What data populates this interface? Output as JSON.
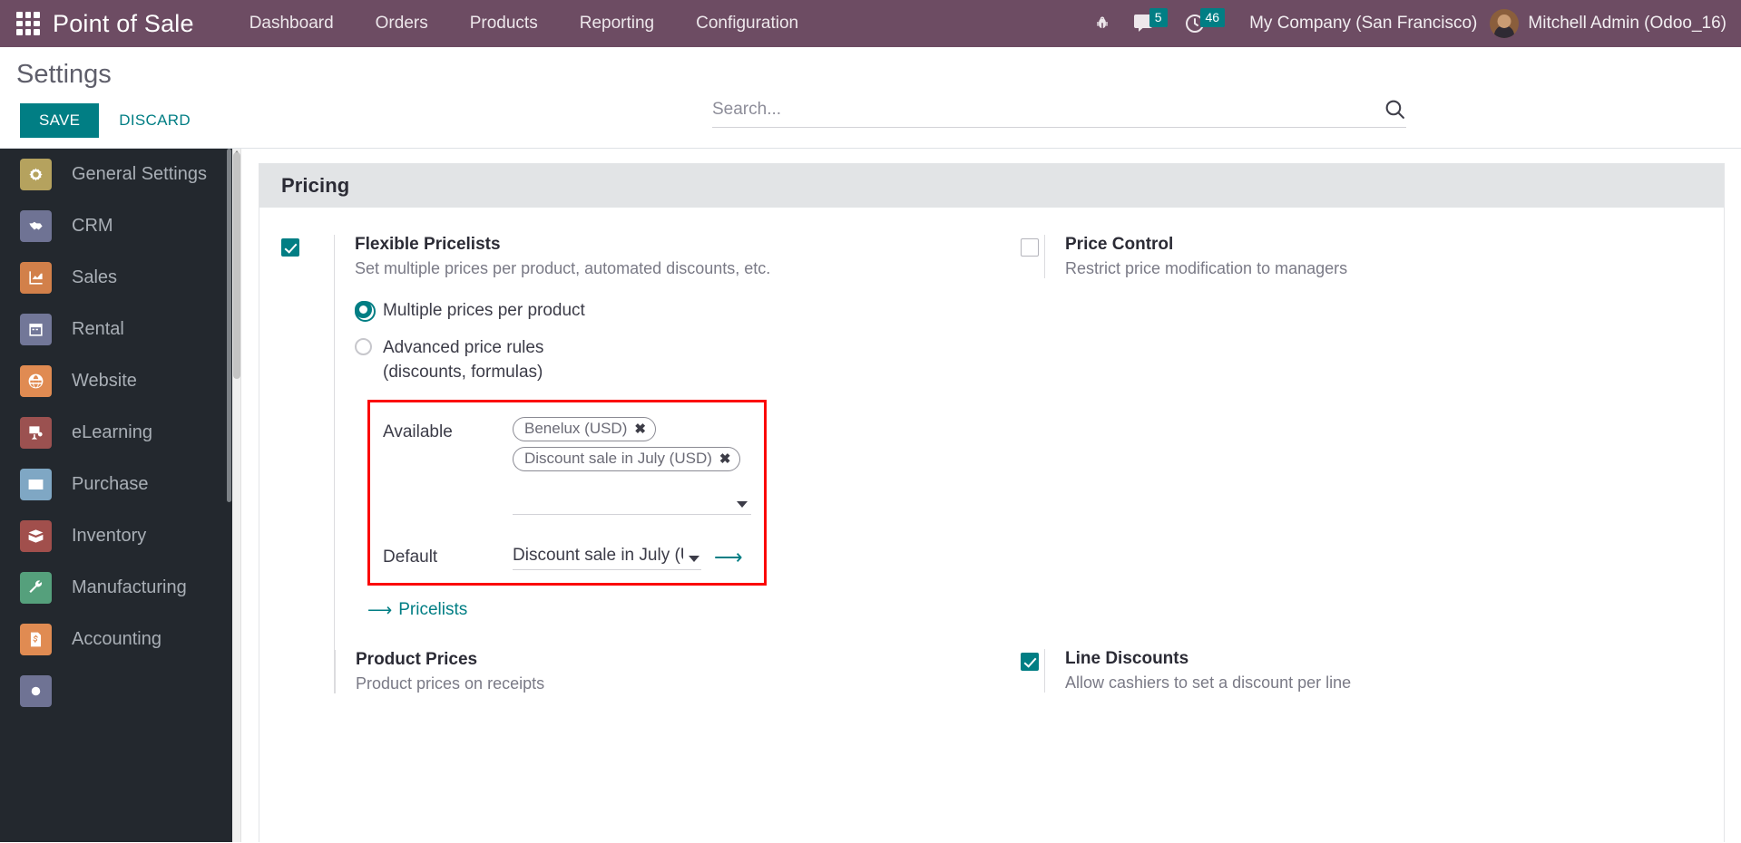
{
  "topbar": {
    "apps_icon": "apps-grid-icon",
    "brand": "Point of Sale",
    "menu": [
      {
        "label": "Dashboard"
      },
      {
        "label": "Orders"
      },
      {
        "label": "Products"
      },
      {
        "label": "Reporting"
      },
      {
        "label": "Configuration"
      }
    ],
    "bug_icon": "bug-icon",
    "messages": {
      "icon": "chat-bubble-icon",
      "count": "5"
    },
    "activities": {
      "icon": "clock-icon",
      "count": "46"
    },
    "company": "My Company (San Francisco)",
    "user": "Mitchell Admin (Odoo_16)",
    "avatar": "user-avatar",
    "accent": "#6d4c63"
  },
  "control_panel": {
    "title": "Settings",
    "save_label": "SAVE",
    "discard_label": "DISCARD",
    "save_color": "#017e84",
    "search": {
      "placeholder": "Search...",
      "value": "",
      "icon": "search-icon"
    }
  },
  "sidebar": {
    "items": [
      {
        "label": "General Settings",
        "icon": "gear-icon",
        "color": "#b5a25e"
      },
      {
        "label": "CRM",
        "icon": "handshake-icon",
        "color": "#6f7394"
      },
      {
        "label": "Sales",
        "icon": "chart-line-icon",
        "color": "#d2804a"
      },
      {
        "label": "Rental",
        "icon": "calendar-icon",
        "color": "#727798"
      },
      {
        "label": "Website",
        "icon": "globe-icon",
        "color": "#e08b52"
      },
      {
        "label": "eLearning",
        "icon": "presentation-icon",
        "color": "#9b5150"
      },
      {
        "label": "Purchase",
        "icon": "credit-card-icon",
        "color": "#7fa7c4"
      },
      {
        "label": "Inventory",
        "icon": "box-icon",
        "color": "#a14f4c"
      },
      {
        "label": "Manufacturing",
        "icon": "wrench-icon",
        "color": "#55a07c"
      },
      {
        "label": "Accounting",
        "icon": "invoice-dollar-icon",
        "color": "#e08b52"
      },
      {
        "label": "",
        "icon": "app-icon",
        "color": "#6f7394"
      }
    ]
  },
  "pricing": {
    "header": "Pricing",
    "flexible_pricelists": {
      "checked": true,
      "title": "Flexible Pricelists",
      "desc": "Set multiple prices per product, automated discounts, etc.",
      "radios": [
        {
          "label": "Multiple prices per product",
          "selected": true
        },
        {
          "label": "Advanced price rules\n(discounts, formulas)",
          "selected": false
        }
      ]
    },
    "price_control": {
      "checked": false,
      "title": "Price Control",
      "desc": "Restrict price modification to managers"
    },
    "highlight_box": {
      "border_color": "#fb0606",
      "available": {
        "label": "Available",
        "tags": [
          {
            "text": "Benelux (USD)",
            "remove_icon": "remove-tag-icon"
          },
          {
            "text": "Discount sale in July (USD)",
            "remove_icon": "remove-tag-icon"
          }
        ],
        "input_value": "",
        "dropdown_icon": "chevron-down-icon"
      },
      "default": {
        "label": "Default",
        "value": "Discount sale in July (USD)",
        "dropdown_icon": "chevron-down-icon",
        "internal_link_icon": "arrow-right-icon"
      }
    },
    "pricelists_link": {
      "label": "Pricelists",
      "icon": "arrow-right-icon"
    },
    "product_prices": {
      "title": "Product Prices",
      "desc": "Product prices on receipts"
    },
    "line_discounts": {
      "checked": true,
      "title": "Line Discounts",
      "desc": "Allow cashiers to set a discount per line"
    }
  }
}
